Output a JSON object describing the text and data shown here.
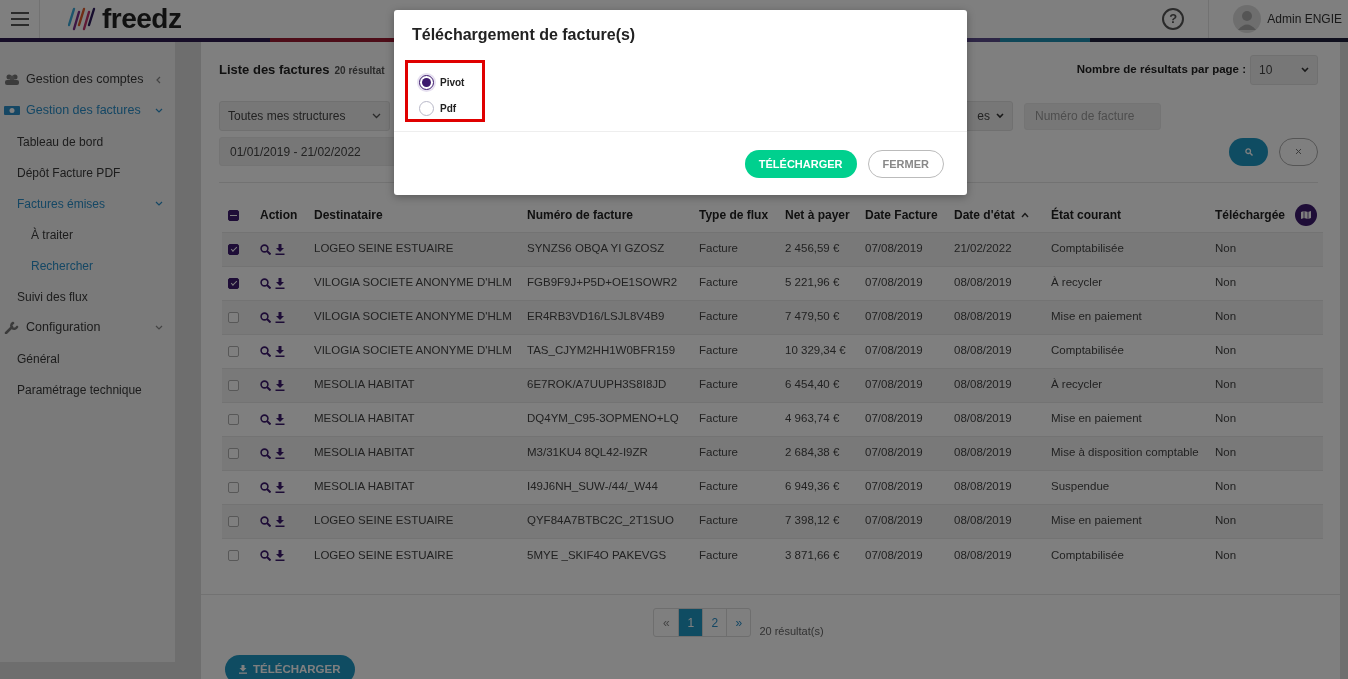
{
  "header": {
    "brand": "freedz",
    "help": "?",
    "user": "Admin ENGIE"
  },
  "sidebar": {
    "items": [
      {
        "label": "Gestion des comptes",
        "active": false,
        "expanded": false
      },
      {
        "label": "Gestion des factures",
        "active": true,
        "expanded": true,
        "children": [
          {
            "label": "Tableau de bord",
            "active": false
          },
          {
            "label": "Dépôt Facture PDF",
            "active": false
          },
          {
            "label": "Factures émises",
            "active": true,
            "expanded": true,
            "children": [
              {
                "label": "À traiter",
                "active": false
              },
              {
                "label": "Rechercher",
                "active": true
              }
            ]
          },
          {
            "label": "Suivi des flux",
            "active": false
          }
        ]
      },
      {
        "label": "Configuration",
        "active": false,
        "expanded": true,
        "children": [
          {
            "label": "Général",
            "active": false
          },
          {
            "label": "Paramétrage technique",
            "active": false
          }
        ]
      }
    ]
  },
  "page": {
    "title": "Liste des factures",
    "count": "20 résultat",
    "per_page_label": "Nombre de résultats par page :",
    "per_page": "10"
  },
  "filters": {
    "structure": "Toutes mes structures",
    "date_range": "01/01/2019 - 21/02/2022",
    "status": "es",
    "invoice_placeholder": "Numéro de facture"
  },
  "table": {
    "select_all_partial": true,
    "action_header": "Action",
    "columns": [
      {
        "label": "Destinataire",
        "sorted": false
      },
      {
        "label": "Numéro de facture",
        "sorted": false
      },
      {
        "label": "Type de flux",
        "sorted": false
      },
      {
        "label": "Net à payer",
        "sorted": false
      },
      {
        "label": "Date Facture",
        "sorted": false
      },
      {
        "label": "Date d'état",
        "sorted": true
      },
      {
        "label": "État courant",
        "sorted": false
      },
      {
        "label": "Téléchargée",
        "sorted": false
      }
    ],
    "rows": [
      {
        "checked": true,
        "cells": [
          "LOGEO SEINE ESTUAIRE",
          "SYNZS6 OBQA YI GZOSZ",
          "Facture",
          "2 456,59 €",
          "07/08/2019",
          "21/02/2022",
          "Comptabilisée",
          "Non"
        ]
      },
      {
        "checked": true,
        "cells": [
          "VILOGIA SOCIETE ANONYME D'HLM",
          "FGB9F9J+P5D+OE1SOWR2",
          "Facture",
          "5 221,96 €",
          "07/08/2019",
          "08/08/2019",
          "À recycler",
          "Non"
        ]
      },
      {
        "checked": false,
        "cells": [
          "VILOGIA SOCIETE ANONYME D'HLM",
          "ER4RB3VD16/LSJL8V4B9",
          "Facture",
          "7 479,50 €",
          "07/08/2019",
          "08/08/2019",
          "Mise en paiement",
          "Non"
        ]
      },
      {
        "checked": false,
        "cells": [
          "VILOGIA SOCIETE ANONYME D'HLM",
          "TAS_CJYM2HH1W0BFR159",
          "Facture",
          "10 329,34 €",
          "07/08/2019",
          "08/08/2019",
          "Comptabilisée",
          "Non"
        ]
      },
      {
        "checked": false,
        "cells": [
          "MESOLIA HABITAT",
          "6E7ROK/A7UUPH3S8I8JD",
          "Facture",
          "6 454,40 €",
          "07/08/2019",
          "08/08/2019",
          "À recycler",
          "Non"
        ]
      },
      {
        "checked": false,
        "cells": [
          "MESOLIA HABITAT",
          "DQ4YM_C95-3OPMENO+LQ",
          "Facture",
          "4 963,74 €",
          "07/08/2019",
          "08/08/2019",
          "Mise en paiement",
          "Non"
        ]
      },
      {
        "checked": false,
        "cells": [
          "MESOLIA HABITAT",
          "M3/31KU4 8QL42-I9ZR",
          "Facture",
          "2 684,38 €",
          "07/08/2019",
          "08/08/2019",
          "Mise à disposition comptable",
          "Non"
        ]
      },
      {
        "checked": false,
        "cells": [
          "MESOLIA HABITAT",
          "I49J6NH_SUW-/44/_W44",
          "Facture",
          "6 949,36 €",
          "07/08/2019",
          "08/08/2019",
          "Suspendue",
          "Non"
        ]
      },
      {
        "checked": false,
        "cells": [
          "LOGEO SEINE ESTUAIRE",
          "QYF84A7BTBC2C_2T1SUO",
          "Facture",
          "7 398,12 €",
          "07/08/2019",
          "08/08/2019",
          "Mise en paiement",
          "Non"
        ]
      },
      {
        "checked": false,
        "cells": [
          "LOGEO SEINE ESTUAIRE",
          "5MYE _SKIF4O PAKEVGS",
          "Facture",
          "3 871,66 €",
          "07/08/2019",
          "08/08/2019",
          "Comptabilisée",
          "Non"
        ]
      }
    ]
  },
  "pagination": {
    "pages": [
      {
        "label": "«",
        "selected": false
      },
      {
        "label": "1",
        "selected": true
      },
      {
        "label": "2",
        "selected": false
      },
      {
        "label": "»",
        "selected": false
      }
    ],
    "summary": "20 résultat(s)"
  },
  "download_button": "TÉLÉCHARGER",
  "modal": {
    "title": "Téléchargement de facture(s)",
    "options": [
      {
        "label": "Pivot",
        "selected": true
      },
      {
        "label": "Pdf",
        "selected": false
      }
    ],
    "buttons": [
      {
        "label": "TÉLÉCHARGER",
        "kind": "primary"
      },
      {
        "label": "FERMER",
        "kind": "secondary"
      }
    ]
  }
}
